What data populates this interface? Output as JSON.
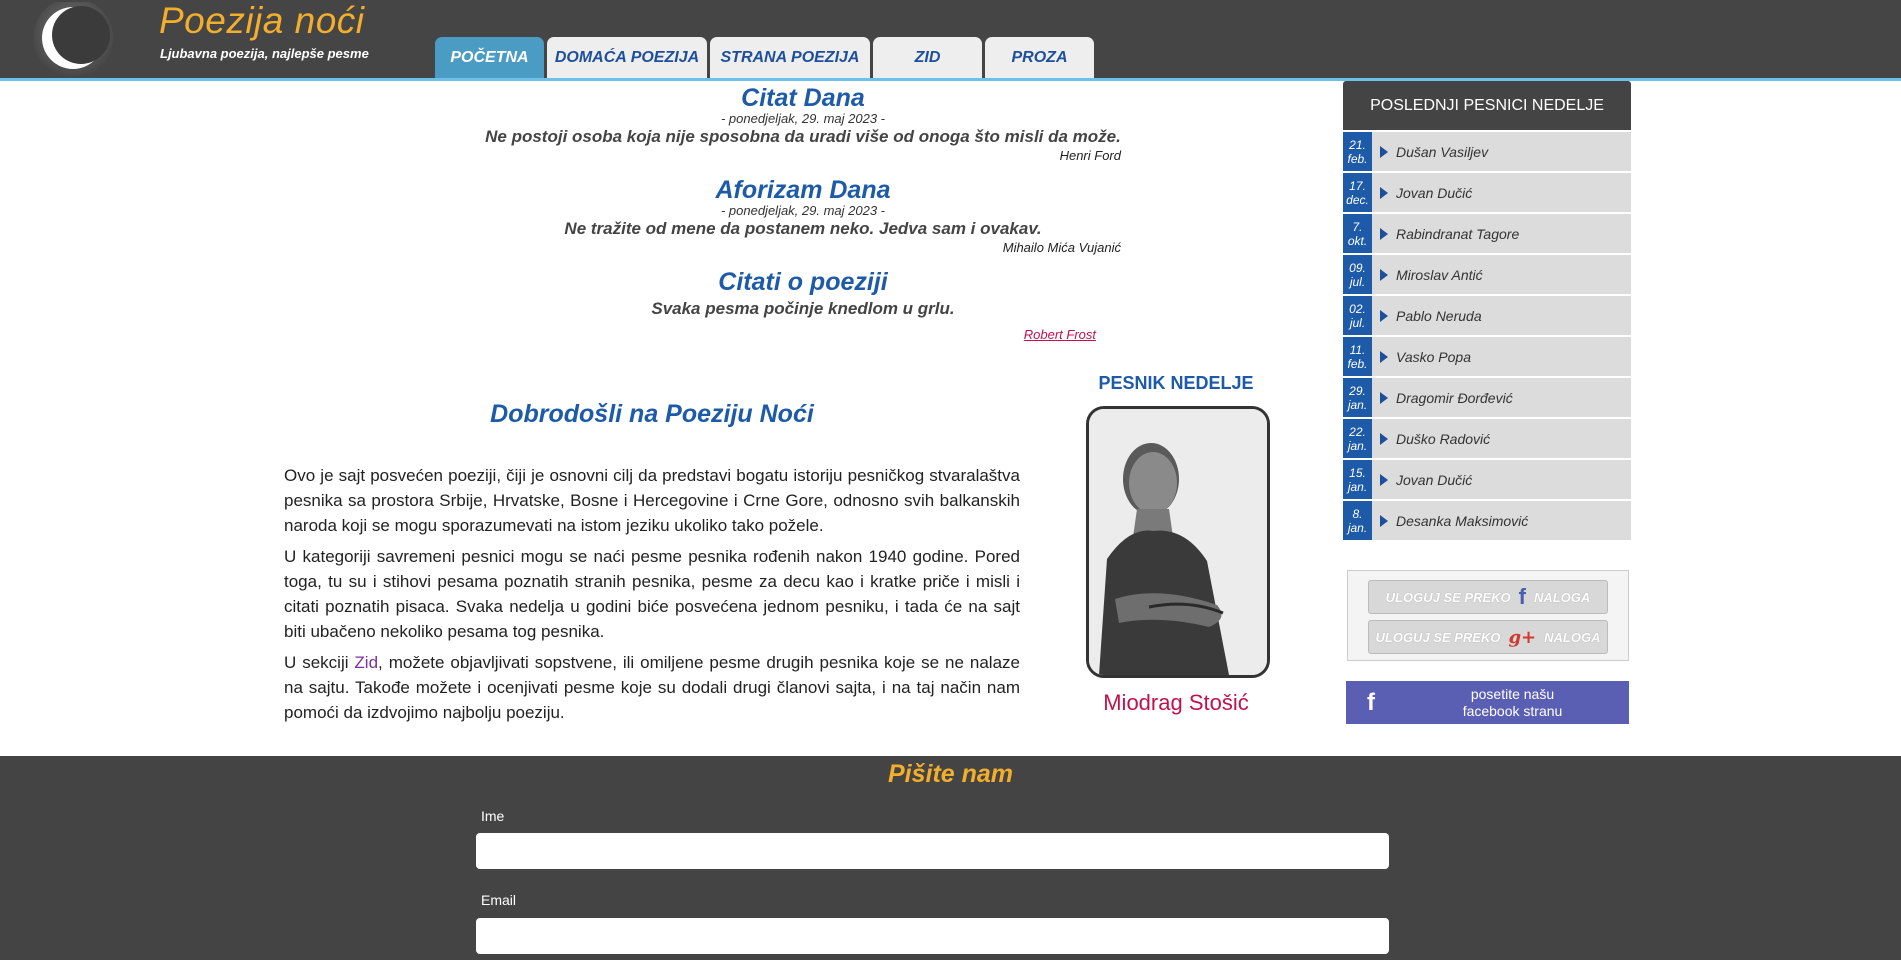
{
  "header": {
    "title": "Poezija noći",
    "subtitle": "Ljubavna poezija, najlepše pesme",
    "nav": [
      "POČETNA",
      "DOMAĆA POEZIJA",
      "STRANA POEZIJA",
      "ZID",
      "PROZA"
    ]
  },
  "quote_of_day": {
    "title": "Citat Dana",
    "date": "- ponedjeljak, 29. maj 2023 -",
    "text": "Ne postoji osoba koja nije sposobna da uradi više od onoga što misli da može.",
    "author": "Henri Ford"
  },
  "aphorism_of_day": {
    "title": "Aforizam Dana",
    "date": "- ponedjeljak, 29. maj 2023 -",
    "text": "Ne tražite od mene da postanem neko. Jedva sam i ovakav.",
    "author": "Mihailo Mića Vujanić"
  },
  "poetry_quotes": {
    "title": "Citati o poeziji",
    "text": "Svaka pesma počinje knedlom u grlu.",
    "author": "Robert Frost"
  },
  "welcome": {
    "title": "Dobrodošli na Poeziju Noći",
    "p1": "Ovo je sajt posvećen poeziji, čiji je osnovni cilj da predstavi bogatu istoriju pesničkog stvaralaštva pesnika sa prostora Srbije, Hrvatske, Bosne i Hercegovine i Crne Gore, odnosno svih balkanskih naroda koji se mogu sporazumevati na istom jeziku ukoliko tako požele.",
    "p2": "U kategoriji savremeni pesnici mogu se naći pesme pesnika rođenih nakon 1940 godine. Pored toga, tu su i stihovi pesama poznatih stranih pesnika, pesme za decu kao i kratke priče i misli i citati poznatih pisaca. Svaka nedelja u godini biće posvećena jednom pesniku, i tada će na sajt biti ubačeno nekoliko pesama tog pesnika.",
    "p3_before": "U sekciji ",
    "p3_link": "Zid",
    "p3_after": ", možete objavljivati sopstvene, ili omiljene pesme drugih pesnika koje se ne nalaze na sajtu. Takođe možete i ocenjivati pesme koje su dodali drugi članovi sajta, i na taj način nam pomoći da izdvojimo najbolju poeziju."
  },
  "poet_of_week": {
    "title": "PESNIK NEDELJE",
    "name": "Miodrag Stošić"
  },
  "sidebar": {
    "title": "POSLEDNJI PESNICI NEDELJE",
    "items": [
      {
        "date": "21.\nfeb.",
        "name": "Dušan Vasiljev"
      },
      {
        "date": "17.\ndec.",
        "name": "Jovan Dučić"
      },
      {
        "date": "7.\nokt.",
        "name": "Rabindranat Tagore"
      },
      {
        "date": "09.\njul.",
        "name": "Miroslav Antić"
      },
      {
        "date": "02.\njul.",
        "name": "Pablo Neruda"
      },
      {
        "date": "11.\nfeb.",
        "name": "Vasko Popa"
      },
      {
        "date": "29.\njan.",
        "name": "Dragomir Đorđević"
      },
      {
        "date": "22.\njan.",
        "name": "Duško Radović"
      },
      {
        "date": "15.\njan.",
        "name": "Jovan Dučić"
      },
      {
        "date": "8.\njan.",
        "name": "Desanka Maksimović"
      }
    ]
  },
  "login": {
    "prefix": "ULOGUJ SE PREKO",
    "suffix": "NALOGA",
    "fb_glyph": "f",
    "gplus_glyph": "g+"
  },
  "facebook_banner": {
    "glyph": "f",
    "line1": "posetite našu",
    "line2": "facebook stranu"
  },
  "footer": {
    "title": "Pišite nam",
    "name_label": "Ime",
    "email_label": "Email"
  }
}
